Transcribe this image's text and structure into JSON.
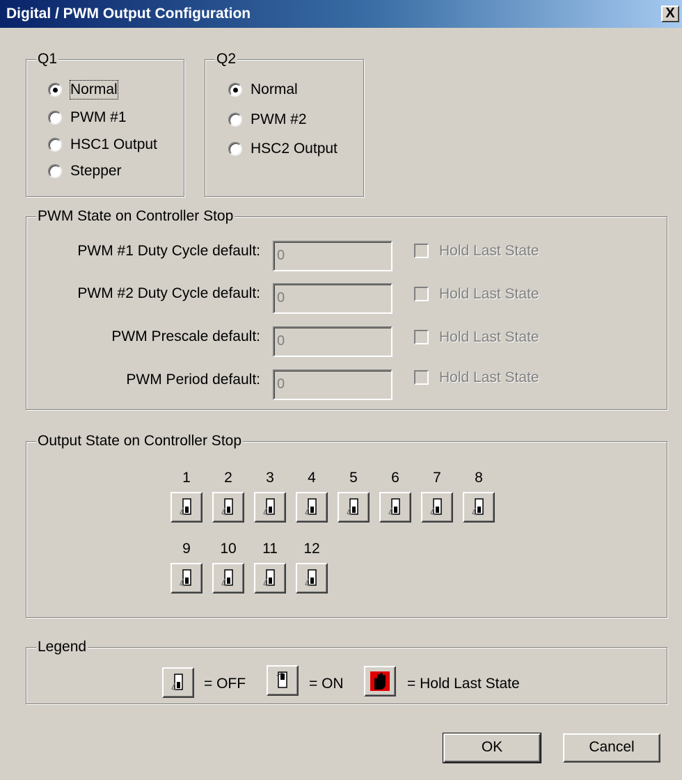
{
  "window": {
    "title": "Digital / PWM Output Configuration",
    "close_glyph": "X"
  },
  "q1": {
    "label": "Q1",
    "options": [
      {
        "label": "Normal",
        "selected": true
      },
      {
        "label": "PWM #1",
        "selected": false
      },
      {
        "label": "HSC1 Output",
        "selected": false
      },
      {
        "label": "Stepper",
        "selected": false
      }
    ]
  },
  "q2": {
    "label": "Q2",
    "options": [
      {
        "label": "Normal",
        "selected": true
      },
      {
        "label": "PWM #2",
        "selected": false
      },
      {
        "label": "HSC2 Output",
        "selected": false
      }
    ]
  },
  "pwm_state": {
    "label": "PWM State on Controller Stop",
    "rows": [
      {
        "label": "PWM #1 Duty Cycle default:",
        "value": "0",
        "hold_label": "Hold Last State",
        "hold_checked": false
      },
      {
        "label": "PWM #2 Duty Cycle default:",
        "value": "0",
        "hold_label": "Hold Last State",
        "hold_checked": false
      },
      {
        "label": "PWM Prescale default:",
        "value": "0",
        "hold_label": "Hold Last State",
        "hold_checked": false
      },
      {
        "label": "PWM Period default:",
        "value": "0",
        "hold_label": "Hold Last State",
        "hold_checked": false
      }
    ]
  },
  "output_state": {
    "label": "Output State on Controller Stop",
    "outputs": [
      "1",
      "2",
      "3",
      "4",
      "5",
      "6",
      "7",
      "8",
      "9",
      "10",
      "11",
      "12"
    ],
    "states": [
      "off",
      "off",
      "off",
      "off",
      "off",
      "off",
      "off",
      "off",
      "off",
      "off",
      "off",
      "off"
    ]
  },
  "legend": {
    "label": "Legend",
    "off_text": "= OFF",
    "on_text": "= ON",
    "hold_text": "= Hold Last State",
    "hold_color": "#e00000"
  },
  "buttons": {
    "ok": "OK",
    "cancel": "Cancel"
  }
}
